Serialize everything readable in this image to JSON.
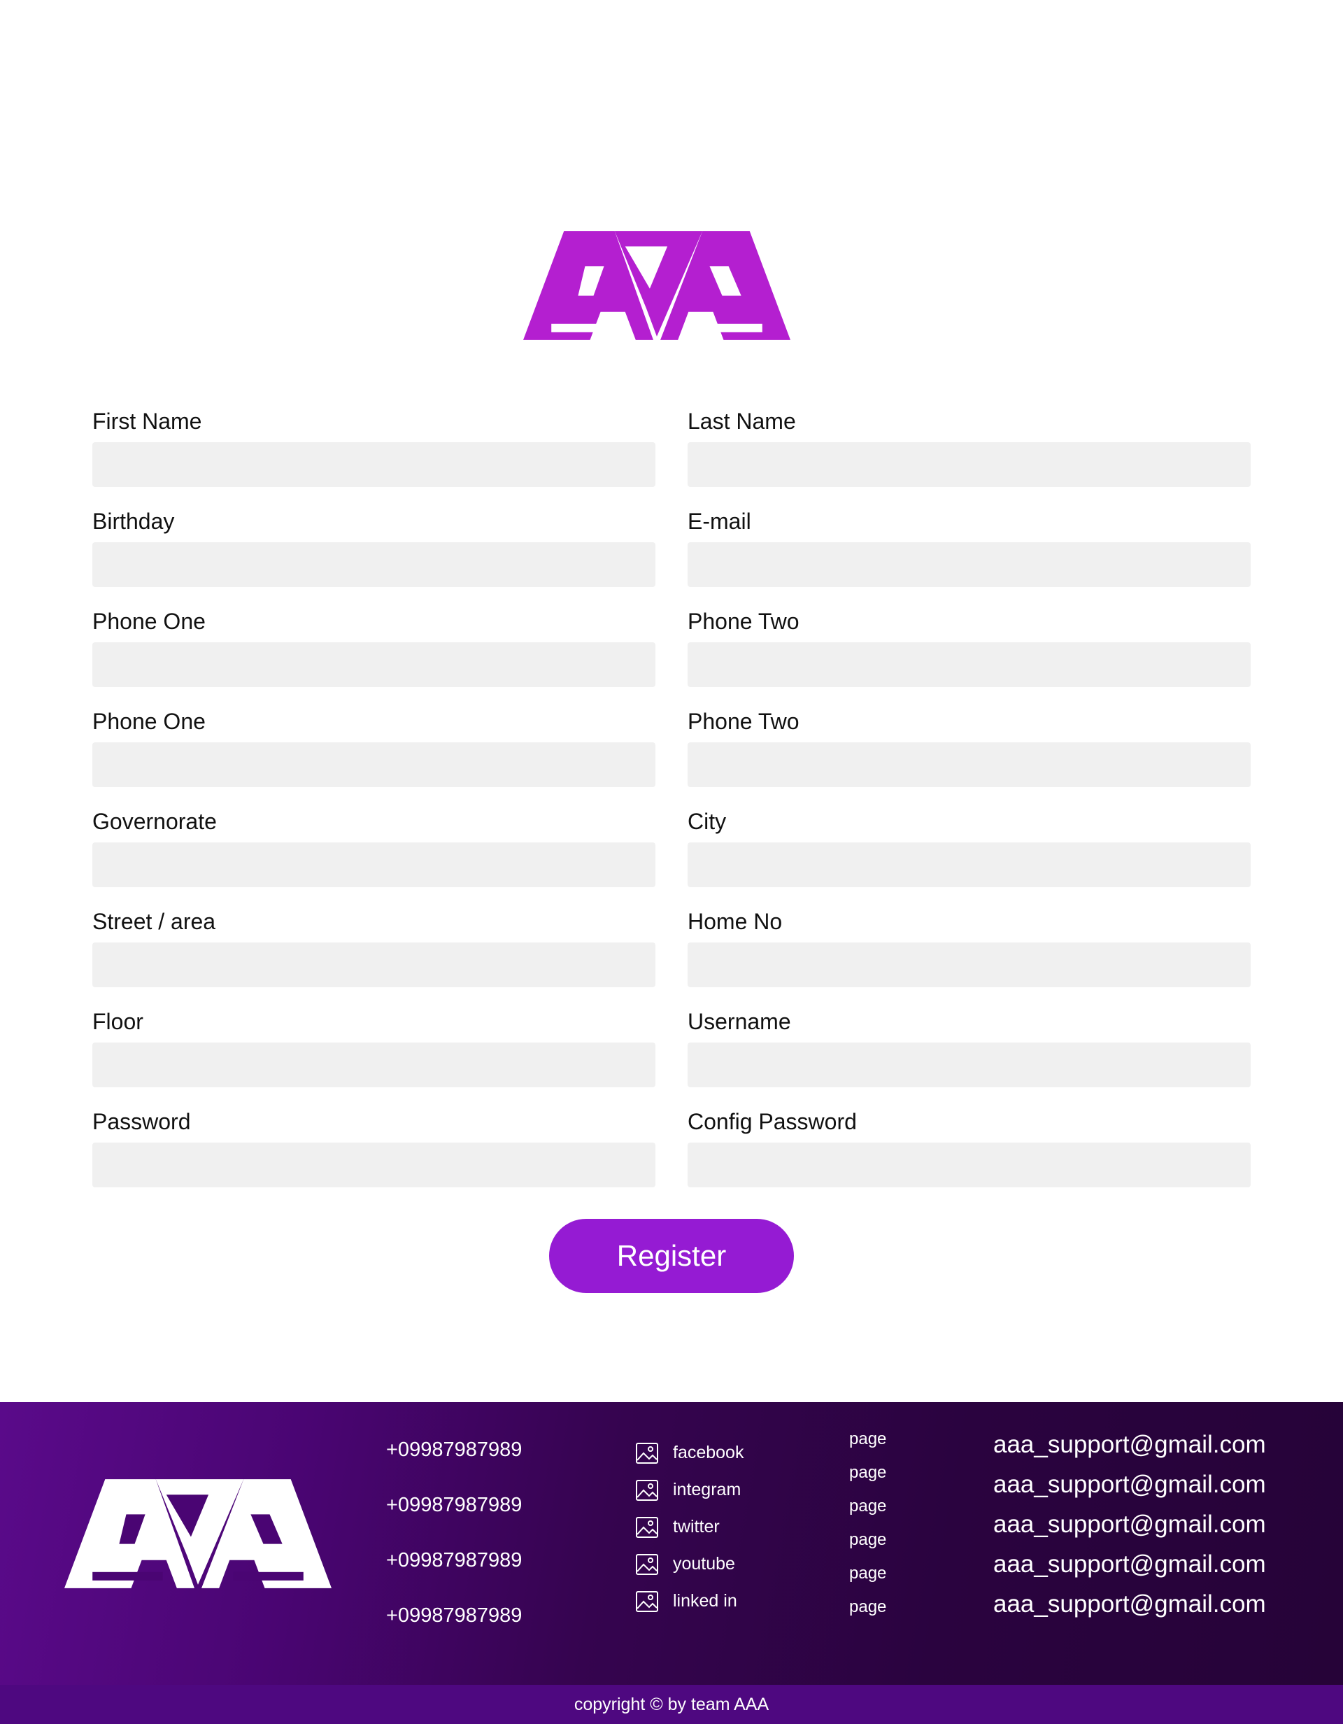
{
  "brand": {
    "logo_text": "AAA",
    "accent_color": "#b41fd0",
    "button_color": "#951bd3"
  },
  "form": {
    "rows": [
      [
        {
          "label": "First Name"
        },
        {
          "label": "Last Name"
        }
      ],
      [
        {
          "label": "Birthday"
        },
        {
          "label": "E-mail"
        }
      ],
      [
        {
          "label": "Phone One"
        },
        {
          "label": "Phone Two"
        }
      ],
      [
        {
          "label": "Phone One"
        },
        {
          "label": "Phone Two"
        }
      ],
      [
        {
          "label": "Governorate"
        },
        {
          "label": "City"
        }
      ],
      [
        {
          "label": "Street / area"
        },
        {
          "label": "Home No"
        }
      ],
      [
        {
          "label": "Floor"
        },
        {
          "label": "Username"
        }
      ],
      [
        {
          "label": "Password"
        },
        {
          "label": "Config Password"
        }
      ]
    ],
    "register_label": "Register"
  },
  "footer": {
    "phones": [
      "+09987987989",
      "+09987987989",
      "+09987987989",
      "+09987987989"
    ],
    "socials": [
      {
        "label": "facebook",
        "icon": "image-icon"
      },
      {
        "label": "integram",
        "icon": "image-icon"
      },
      {
        "label": "twitter",
        "icon": "image-icon"
      },
      {
        "label": "youtube",
        "icon": "image-icon"
      },
      {
        "label": "linked in",
        "icon": "image-icon"
      }
    ],
    "pages": [
      "page",
      "page",
      "page",
      "page",
      "page",
      "page"
    ],
    "emails": [
      "aaa_support@gmail.com",
      "aaa_support@gmail.com",
      "aaa_support@gmail.com",
      "aaa_support@gmail.com",
      "aaa_support@gmail.com"
    ],
    "copyright": "copyright © by team AAA"
  }
}
